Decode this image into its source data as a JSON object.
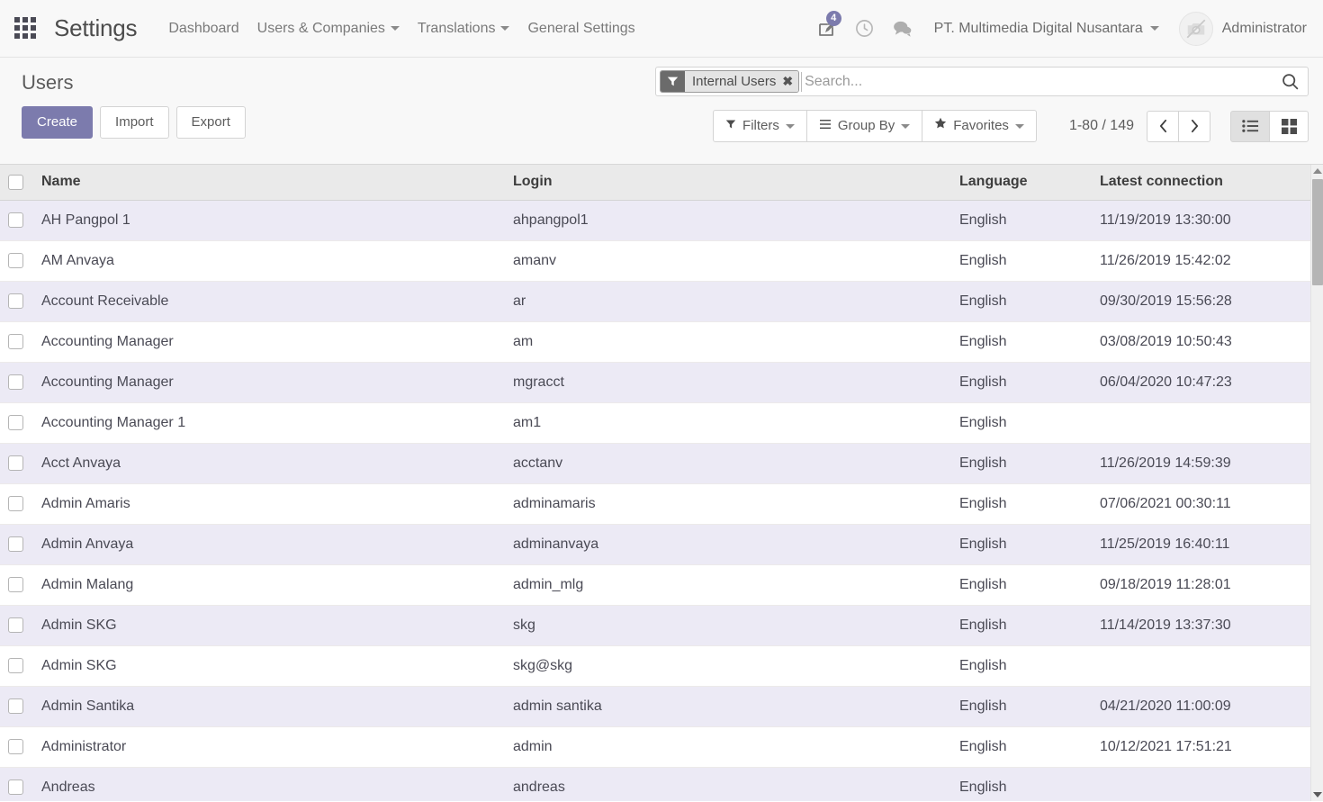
{
  "navbar": {
    "apps_icon": "apps-grid-icon",
    "brand": "Settings",
    "menus": [
      {
        "label": "Dashboard",
        "has_caret": false
      },
      {
        "label": "Users & Companies",
        "has_caret": true
      },
      {
        "label": "Translations",
        "has_caret": true
      },
      {
        "label": "General Settings",
        "has_caret": false
      }
    ],
    "activity_icon": "activity-pencil-icon",
    "activity_badge": "4",
    "clock_icon": "clock-icon",
    "messages_icon": "chat-bubble-icon",
    "company": "PT. Multimedia Digital Nusantara",
    "avatar_icon": "no-camera-avatar-icon",
    "username": "Administrator"
  },
  "control_panel": {
    "title": "Users",
    "create_label": "Create",
    "import_label": "Import",
    "export_label": "Export",
    "search": {
      "facet_label": "Internal Users",
      "facet_icon": "filter-funnel-icon",
      "facet_remove_icon": "close-x-icon",
      "placeholder": "Search...",
      "value": "",
      "magnifier_icon": "search-icon"
    },
    "filters_label": "Filters",
    "filters_icon": "filter-funnel-icon",
    "groupby_label": "Group By",
    "groupby_icon": "hamburger-lines-icon",
    "favorites_label": "Favorites",
    "favorites_icon": "star-icon",
    "pager": "1-80 / 149",
    "prev_icon": "chevron-left-icon",
    "next_icon": "chevron-right-icon",
    "view_list_icon": "list-view-icon",
    "view_kanban_icon": "kanban-view-icon",
    "active_view": "list"
  },
  "table": {
    "columns": [
      "Name",
      "Login",
      "Language",
      "Latest connection"
    ],
    "select_all_icon": "checkbox-icon",
    "rows": [
      {
        "name": "AH Pangpol 1",
        "login": "ahpangpol1",
        "language": "English",
        "latest": "11/19/2019 13:30:00"
      },
      {
        "name": "AM Anvaya",
        "login": "amanv",
        "language": "English",
        "latest": "11/26/2019 15:42:02"
      },
      {
        "name": "Account Receivable",
        "login": "ar",
        "language": "English",
        "latest": "09/30/2019 15:56:28"
      },
      {
        "name": "Accounting Manager",
        "login": "am",
        "language": "English",
        "latest": "03/08/2019 10:50:43"
      },
      {
        "name": "Accounting Manager",
        "login": "mgracct",
        "language": "English",
        "latest": "06/04/2020 10:47:23"
      },
      {
        "name": "Accounting Manager 1",
        "login": "am1",
        "language": "English",
        "latest": ""
      },
      {
        "name": "Acct Anvaya",
        "login": "acctanv",
        "language": "English",
        "latest": "11/26/2019 14:59:39"
      },
      {
        "name": "Admin Amaris",
        "login": "adminamaris",
        "language": "English",
        "latest": "07/06/2021 00:30:11"
      },
      {
        "name": "Admin Anvaya",
        "login": "adminanvaya",
        "language": "English",
        "latest": "11/25/2019 16:40:11"
      },
      {
        "name": "Admin Malang",
        "login": "admin_mlg",
        "language": "English",
        "latest": "09/18/2019 11:28:01"
      },
      {
        "name": "Admin SKG",
        "login": "skg",
        "language": "English",
        "latest": "11/14/2019 13:37:30"
      },
      {
        "name": "Admin SKG",
        "login": "skg@skg",
        "language": "English",
        "latest": ""
      },
      {
        "name": "Admin Santika",
        "login": "admin santika",
        "language": "English",
        "latest": "04/21/2020 11:00:09"
      },
      {
        "name": "Administrator",
        "login": "admin",
        "language": "English",
        "latest": "10/12/2021 17:51:21"
      },
      {
        "name": "Andreas",
        "login": "andreas",
        "language": "English",
        "latest": ""
      }
    ]
  },
  "scrollbar": {
    "up_icon": "triangle-up-icon",
    "down_icon": "triangle-down-icon"
  },
  "colors": {
    "accent": "#7c7bad",
    "row_stripe": "#eceaf5",
    "header_bg": "#f8f8f8"
  }
}
